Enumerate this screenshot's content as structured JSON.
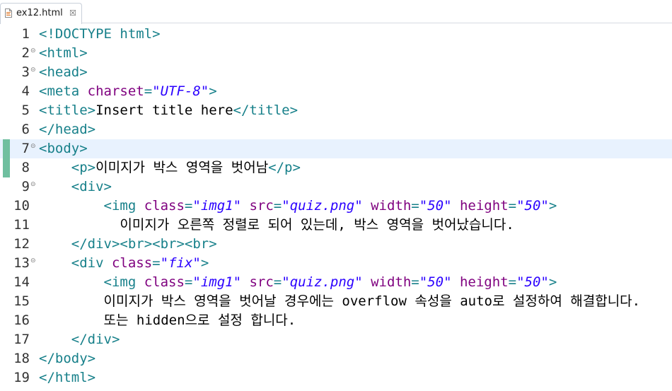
{
  "tab": {
    "label": "ex12.html",
    "close_glyph": "☒"
  },
  "gutter": {
    "fold_glyph": "⊝"
  },
  "colors": {
    "tag": "#17808a",
    "attribute": "#7f007f",
    "value": "#2a00ff",
    "text": "#000000",
    "current_line": "#e8f2fe",
    "change_marker": "#6fbf9f"
  },
  "current_line_number": 7,
  "lines": [
    {
      "num": "1",
      "fold": false,
      "changed": false,
      "tokens": [
        {
          "t": "tg",
          "v": "<!DOCTYPE html>"
        }
      ]
    },
    {
      "num": "2",
      "fold": true,
      "changed": false,
      "tokens": [
        {
          "t": "tg",
          "v": "<html>"
        }
      ]
    },
    {
      "num": "3",
      "fold": true,
      "changed": false,
      "tokens": [
        {
          "t": "tg",
          "v": "<head>"
        }
      ]
    },
    {
      "num": "4",
      "fold": false,
      "changed": false,
      "tokens": [
        {
          "t": "tg",
          "v": "<meta "
        },
        {
          "t": "at",
          "v": "charset"
        },
        {
          "t": "tg",
          "v": "="
        },
        {
          "t": "vl",
          "v": "\"UTF-8\""
        },
        {
          "t": "tg",
          "v": ">"
        }
      ]
    },
    {
      "num": "5",
      "fold": false,
      "changed": false,
      "tokens": [
        {
          "t": "tg",
          "v": "<title>"
        },
        {
          "t": "tx",
          "v": "Insert title here"
        },
        {
          "t": "tg",
          "v": "</title>"
        }
      ]
    },
    {
      "num": "6",
      "fold": false,
      "changed": false,
      "tokens": [
        {
          "t": "tg",
          "v": "</head>"
        }
      ]
    },
    {
      "num": "7",
      "fold": true,
      "changed": true,
      "tokens": [
        {
          "t": "tg",
          "v": "<body>"
        }
      ]
    },
    {
      "num": "8",
      "fold": false,
      "changed": true,
      "tokens": [
        {
          "t": "tx",
          "v": "    "
        },
        {
          "t": "tg",
          "v": "<p>"
        },
        {
          "t": "tx",
          "v": "이미지가 박스 영역을 벗어남"
        },
        {
          "t": "tg",
          "v": "</p>"
        }
      ]
    },
    {
      "num": "9",
      "fold": true,
      "changed": false,
      "tokens": [
        {
          "t": "tx",
          "v": "    "
        },
        {
          "t": "tg",
          "v": "<div>"
        }
      ]
    },
    {
      "num": "10",
      "fold": false,
      "changed": false,
      "tokens": [
        {
          "t": "tx",
          "v": "        "
        },
        {
          "t": "tg",
          "v": "<img "
        },
        {
          "t": "at",
          "v": "class"
        },
        {
          "t": "tg",
          "v": "="
        },
        {
          "t": "vl",
          "v": "\"img1\""
        },
        {
          "t": "tx",
          "v": " "
        },
        {
          "t": "at",
          "v": "src"
        },
        {
          "t": "tg",
          "v": "="
        },
        {
          "t": "vl",
          "v": "\"quiz.png\""
        },
        {
          "t": "tx",
          "v": " "
        },
        {
          "t": "at",
          "v": "width"
        },
        {
          "t": "tg",
          "v": "="
        },
        {
          "t": "vl",
          "v": "\"50\""
        },
        {
          "t": "tx",
          "v": " "
        },
        {
          "t": "at",
          "v": "height"
        },
        {
          "t": "tg",
          "v": "="
        },
        {
          "t": "vl",
          "v": "\"50\""
        },
        {
          "t": "tg",
          "v": ">"
        }
      ]
    },
    {
      "num": "11",
      "fold": false,
      "changed": false,
      "tokens": [
        {
          "t": "tx",
          "v": "          이미지가 오른쪽 정렬로 되어 있는데, 박스 영역을 벗어났습니다."
        }
      ]
    },
    {
      "num": "12",
      "fold": false,
      "changed": false,
      "tokens": [
        {
          "t": "tx",
          "v": "    "
        },
        {
          "t": "tg",
          "v": "</div><br><br><br>"
        }
      ]
    },
    {
      "num": "13",
      "fold": true,
      "changed": false,
      "tokens": [
        {
          "t": "tx",
          "v": "    "
        },
        {
          "t": "tg",
          "v": "<div "
        },
        {
          "t": "at",
          "v": "class"
        },
        {
          "t": "tg",
          "v": "="
        },
        {
          "t": "vl",
          "v": "\"fix\""
        },
        {
          "t": "tg",
          "v": ">"
        }
      ]
    },
    {
      "num": "14",
      "fold": false,
      "changed": false,
      "tokens": [
        {
          "t": "tx",
          "v": "        "
        },
        {
          "t": "tg",
          "v": "<img "
        },
        {
          "t": "at",
          "v": "class"
        },
        {
          "t": "tg",
          "v": "="
        },
        {
          "t": "vl",
          "v": "\"img1\""
        },
        {
          "t": "tx",
          "v": " "
        },
        {
          "t": "at",
          "v": "src"
        },
        {
          "t": "tg",
          "v": "="
        },
        {
          "t": "vl",
          "v": "\"quiz.png\""
        },
        {
          "t": "tx",
          "v": " "
        },
        {
          "t": "at",
          "v": "width"
        },
        {
          "t": "tg",
          "v": "="
        },
        {
          "t": "vl",
          "v": "\"50\""
        },
        {
          "t": "tx",
          "v": " "
        },
        {
          "t": "at",
          "v": "height"
        },
        {
          "t": "tg",
          "v": "="
        },
        {
          "t": "vl",
          "v": "\"50\""
        },
        {
          "t": "tg",
          "v": ">"
        }
      ]
    },
    {
      "num": "15",
      "fold": false,
      "changed": false,
      "tokens": [
        {
          "t": "tx",
          "v": "        이미지가 박스 영역을 벗어날 경우에는 overflow 속성을 auto로 설정하여 해결합니다."
        }
      ]
    },
    {
      "num": "16",
      "fold": false,
      "changed": false,
      "tokens": [
        {
          "t": "tx",
          "v": "        또는 hidden으로 설정 합니다."
        }
      ]
    },
    {
      "num": "17",
      "fold": false,
      "changed": false,
      "tokens": [
        {
          "t": "tx",
          "v": "    "
        },
        {
          "t": "tg",
          "v": "</div>"
        }
      ]
    },
    {
      "num": "18",
      "fold": false,
      "changed": false,
      "tokens": [
        {
          "t": "tg",
          "v": "</body>"
        }
      ]
    },
    {
      "num": "19",
      "fold": false,
      "changed": false,
      "tokens": [
        {
          "t": "tg",
          "v": "</html>"
        }
      ]
    }
  ]
}
